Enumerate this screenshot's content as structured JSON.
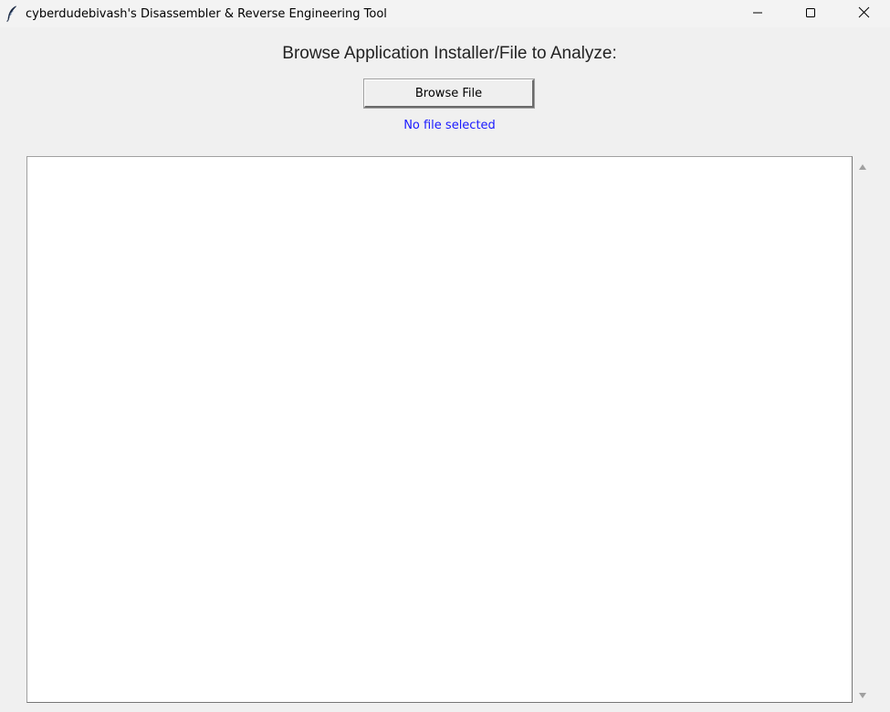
{
  "window": {
    "title": "cyberdudebivash's Disassembler & Reverse Engineering Tool",
    "app_icon": "feather-icon",
    "controls": {
      "minimize_icon": "minimize-icon",
      "maximize_icon": "maximize-icon",
      "close_icon": "close-icon"
    }
  },
  "main": {
    "heading": "Browse Application Installer/File to Analyze:",
    "browse_button_label": "Browse File",
    "file_status": "No file selected",
    "output_text": ""
  },
  "scrollbar": {
    "up_icon": "scroll-up-arrow-icon",
    "down_icon": "scroll-down-arrow-icon"
  },
  "colors": {
    "background": "#f0f0f0",
    "status_text": "#1a1aff",
    "output_background": "#ffffff"
  }
}
